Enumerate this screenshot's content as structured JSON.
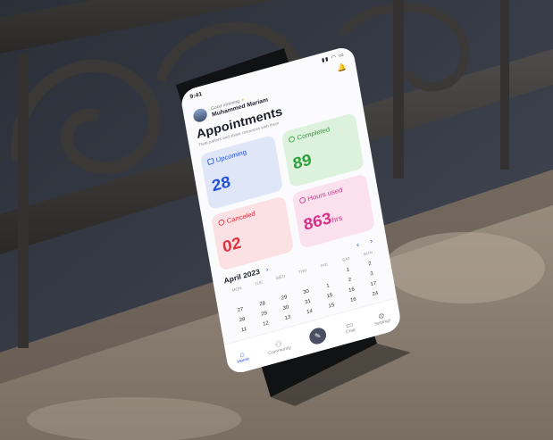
{
  "status": {
    "time": "9:41",
    "icons": "▮▮ ◠ ▭"
  },
  "profile": {
    "greeting": "Good morning",
    "name": "Muhammed Mariam"
  },
  "header": {
    "title": "Appointments",
    "subtitle": "Treat patient and share resources with them"
  },
  "cards": {
    "upcoming": {
      "label": "Upcoming",
      "value": "28"
    },
    "completed": {
      "label": "Completed",
      "value": "89"
    },
    "canceled": {
      "label": "Canceled",
      "value": "02"
    },
    "hours": {
      "label": "Hours used",
      "value": "863",
      "unit": "hrs"
    }
  },
  "calendar": {
    "month": "April 2023",
    "weekdays": [
      "MON",
      "TUE",
      "WED",
      "THU",
      "FRI",
      "SAT",
      "SUN"
    ],
    "weeks": [
      [
        "",
        "",
        "",
        "",
        "",
        "1",
        "2"
      ],
      [
        "27",
        "28",
        "29",
        "30",
        "1",
        "2",
        "3"
      ],
      [
        "28",
        "29",
        "30",
        "31",
        "15",
        "16",
        "17"
      ],
      [
        "11",
        "12",
        "13",
        "14",
        "15",
        "16",
        "24"
      ]
    ]
  },
  "tabs": [
    "Home",
    "Community",
    "",
    "Chat",
    "Settings"
  ],
  "colors": {
    "upcoming": "#2352d9",
    "completed": "#2ea23a",
    "canceled": "#e0313c",
    "hours": "#d9308a"
  }
}
